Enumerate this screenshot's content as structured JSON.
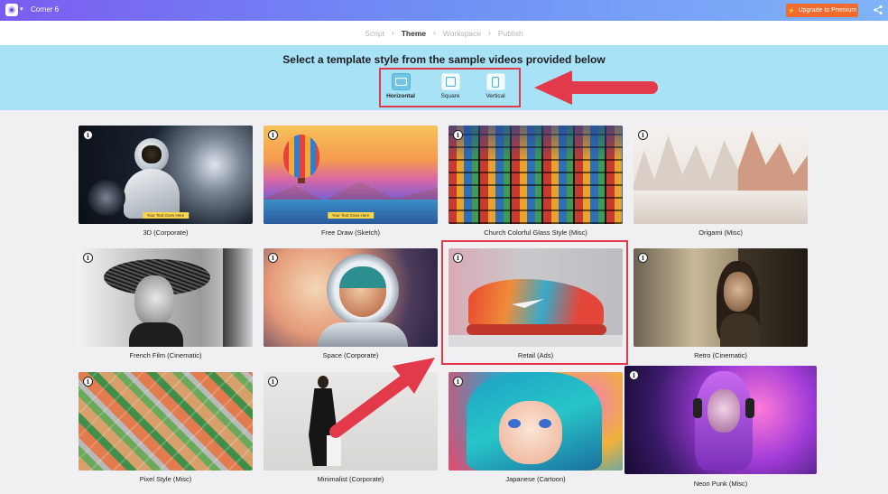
{
  "app": {
    "project_name": "Corner 6",
    "upgrade_label": "Upgrade to Premium"
  },
  "steps": [
    {
      "label": "Script",
      "active": false
    },
    {
      "label": "Theme",
      "active": true
    },
    {
      "label": "Workspace",
      "active": false
    },
    {
      "label": "Publish",
      "active": false
    }
  ],
  "selector": {
    "title": "Select a template style from the sample videos provided below",
    "orientations": [
      {
        "label": "Horizontal",
        "selected": true
      },
      {
        "label": "Square",
        "selected": false
      },
      {
        "label": "Vertical",
        "selected": false
      }
    ]
  },
  "templates": [
    {
      "label": "3D (Corporate)",
      "caption": "Your Text Goes Here"
    },
    {
      "label": "Free Draw (Sketch)",
      "caption": "Your Text Goes Here"
    },
    {
      "label": "Church Colorful Glass Style (Misc)"
    },
    {
      "label": "Origami (Misc)"
    },
    {
      "label": "French Film (Cinematic)"
    },
    {
      "label": "Space (Corporate)"
    },
    {
      "label": "Retail (Ads)"
    },
    {
      "label": "Retro (Cinematic)"
    },
    {
      "label": "Pixel Style (Misc)"
    },
    {
      "label": "Minimalist (Corporate)"
    },
    {
      "label": "Japanese (Cartoon)"
    },
    {
      "label": "Neon Punk (Misc)"
    }
  ],
  "colors": {
    "accent": "#6ec5e6",
    "annotation": "#e23a4a",
    "upgrade": "#f26a2e"
  }
}
